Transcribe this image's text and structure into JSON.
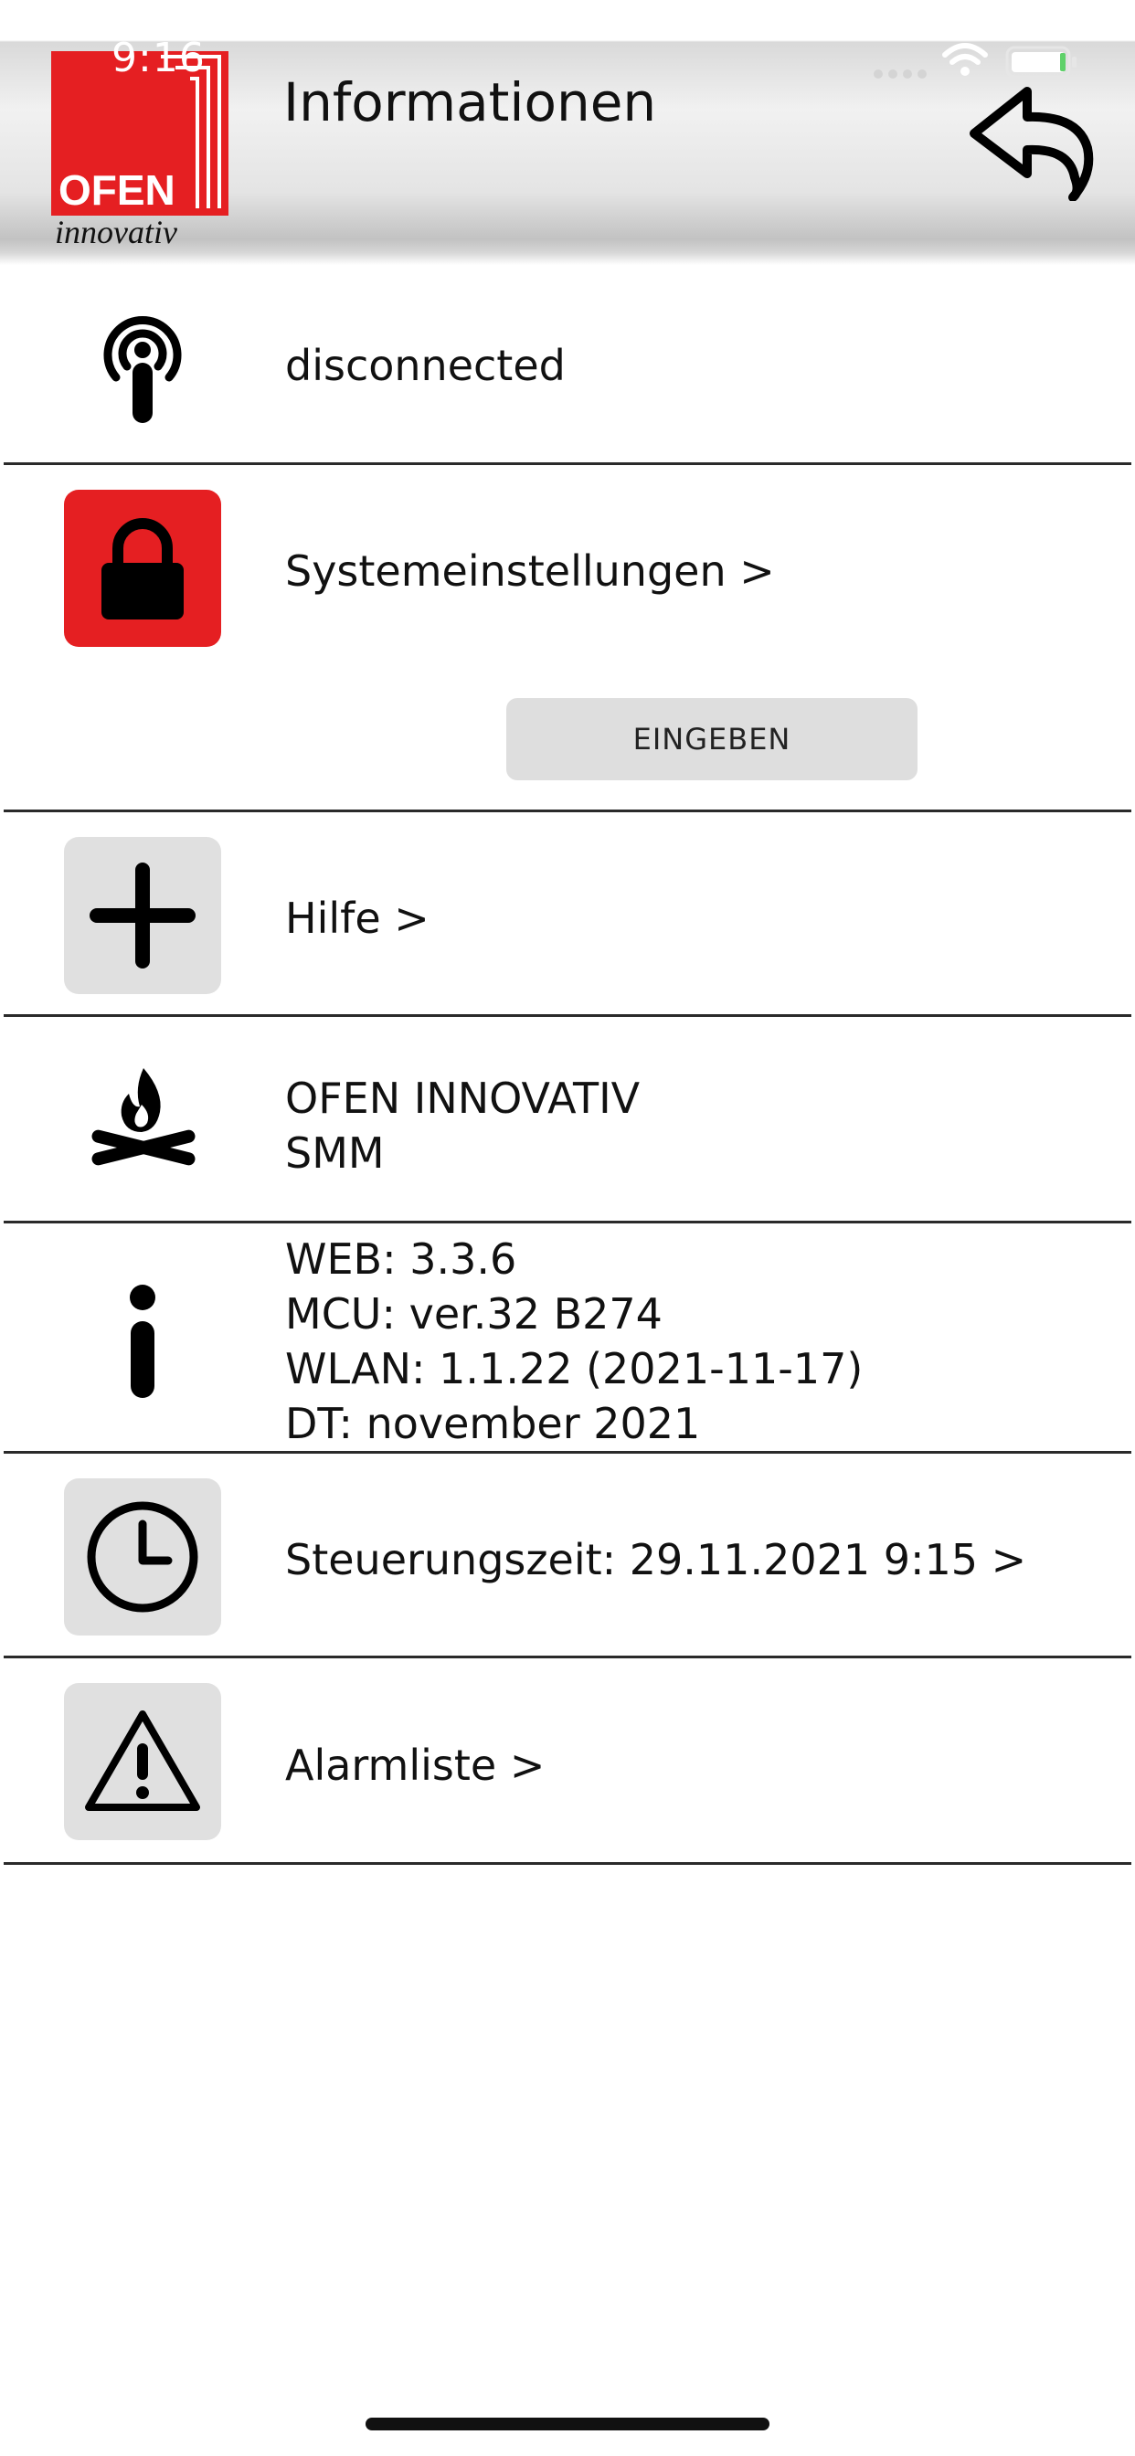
{
  "status_bar": {
    "time": "9:16"
  },
  "header": {
    "title": "Informationen",
    "logo": {
      "brand": "OFEN",
      "tagline": "innovativ",
      "brand_color": "#e51f22"
    }
  },
  "rows": {
    "connection": {
      "label": "disconnected",
      "icon": "broadcast-icon"
    },
    "system": {
      "label": "Systemeinstellungen >",
      "icon": "lock-icon",
      "button": "EINGEBEN"
    },
    "help": {
      "label": "Hilfe >",
      "icon": "plus-icon"
    },
    "device": {
      "line1": "OFEN INNOVATIV",
      "line2": "SMM",
      "icon": "campfire-icon"
    },
    "versions": {
      "icon": "info-icon",
      "web": "WEB: 3.3.6",
      "mcu": "MCU: ver.32 B274",
      "wlan": "WLAN: 1.1.22 (2021-11-17)",
      "dt": "DT: november 2021"
    },
    "time": {
      "label": "Steuerungszeit: 29.11.2021 9:15 >",
      "icon": "clock-icon"
    },
    "alarms": {
      "label": "Alarmliste >",
      "icon": "warning-icon"
    }
  },
  "colors": {
    "accent_red": "#e51f22",
    "tile_gray": "#e0e0e0",
    "divider": "#2a2a2a"
  }
}
